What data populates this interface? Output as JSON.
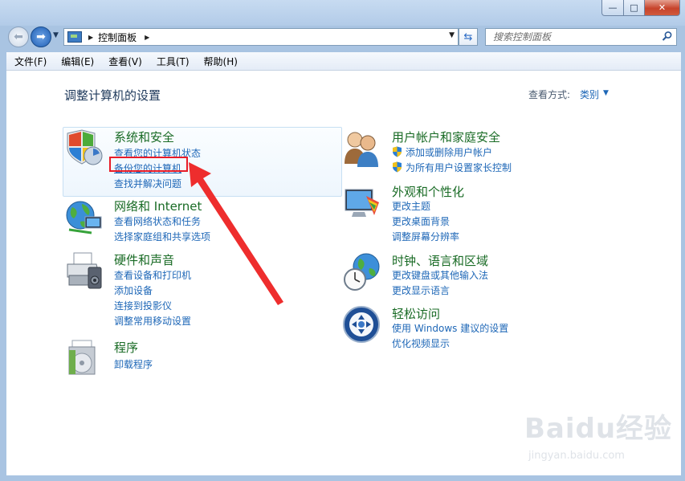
{
  "window": {
    "min_label": "—",
    "max_label": "□",
    "close_label": "✕"
  },
  "nav": {
    "breadcrumb": "控制面板",
    "search_placeholder": "搜索控制面板"
  },
  "menubar": [
    {
      "label": "文件(F)"
    },
    {
      "label": "编辑(E)"
    },
    {
      "label": "查看(V)"
    },
    {
      "label": "工具(T)"
    },
    {
      "label": "帮助(H)"
    }
  ],
  "main": {
    "title": "调整计算机的设置",
    "view_by_label": "查看方式:",
    "view_by_value": "类别"
  },
  "categories": [
    {
      "title": "系统和安全",
      "icon": "shield-monitor-icon",
      "links": [
        "查看您的计算机状态",
        "备份您的计算机",
        "查找并解决问题"
      ]
    },
    {
      "title": "网络和 Internet",
      "icon": "globe-network-icon",
      "links": [
        "查看网络状态和任务",
        "选择家庭组和共享选项"
      ]
    },
    {
      "title": "硬件和声音",
      "icon": "printer-icon",
      "links": [
        "查看设备和打印机",
        "添加设备",
        "连接到投影仪",
        "调整常用移动设置"
      ]
    },
    {
      "title": "程序",
      "icon": "programs-icon",
      "links": [
        "卸载程序"
      ]
    },
    {
      "title": "用户帐户和家庭安全",
      "icon": "users-icon",
      "links": [
        "添加或删除用户帐户",
        "为所有用户设置家长控制"
      ]
    },
    {
      "title": "外观和个性化",
      "icon": "display-paint-icon",
      "links": [
        "更改主题",
        "更改桌面背景",
        "调整屏幕分辨率"
      ]
    },
    {
      "title": "时钟、语言和区域",
      "icon": "clock-globe-icon",
      "links": [
        "更改键盘或其他输入法",
        "更改显示语言"
      ]
    },
    {
      "title": "轻松访问",
      "icon": "accessibility-icon",
      "links": [
        "使用 Windows 建议的设置",
        "优化视频显示"
      ]
    }
  ],
  "colors": {
    "category_title": "#196b25",
    "link": "#1e67b7",
    "highlight": "#e81c28"
  },
  "watermark": {
    "logo": "Baidu经验",
    "url": "jingyan.baidu.com"
  }
}
